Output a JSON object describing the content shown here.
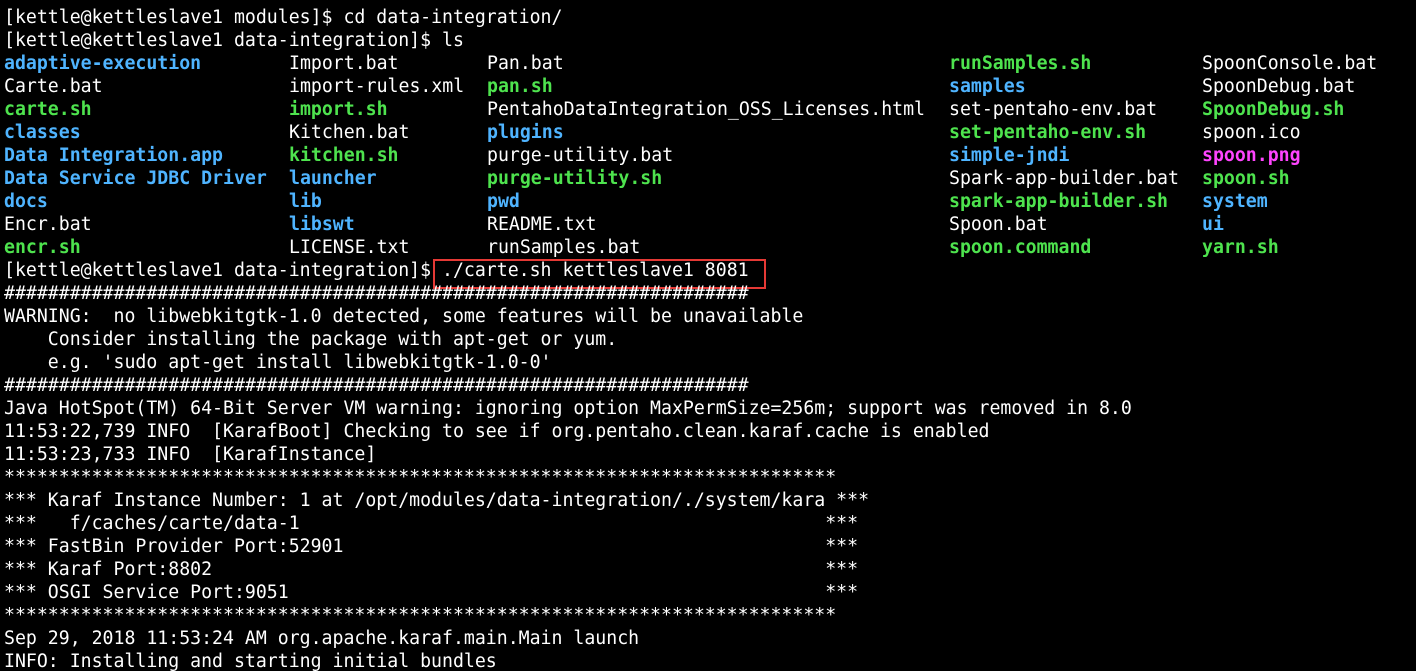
{
  "colors": {
    "background": "#000000",
    "plain": "#ffffff",
    "directory": "#4fb4ff",
    "executable": "#4ee34e",
    "image": "#ff44ff",
    "highlight": "#e53935"
  },
  "terminal": {
    "line1": "[kettle@kettleslave1 modules]$ cd data-integration/",
    "line2": "[kettle@kettleslave1 data-integration]$ ls",
    "listing": [
      [
        {
          "text": "adaptive-execution",
          "type": "dir"
        },
        {
          "text": "Import.bat",
          "type": "plain"
        },
        {
          "text": "Pan.bat",
          "type": "plain"
        },
        {
          "text": "runSamples.sh",
          "type": "exec"
        },
        {
          "text": "SpoonConsole.bat",
          "type": "plain"
        }
      ],
      [
        {
          "text": "Carte.bat",
          "type": "plain"
        },
        {
          "text": "import-rules.xml",
          "type": "plain"
        },
        {
          "text": "pan.sh",
          "type": "exec"
        },
        {
          "text": "samples",
          "type": "dir"
        },
        {
          "text": "SpoonDebug.bat",
          "type": "plain"
        }
      ],
      [
        {
          "text": "carte.sh",
          "type": "exec"
        },
        {
          "text": "import.sh",
          "type": "exec"
        },
        {
          "text": "PentahoDataIntegration_OSS_Licenses.html",
          "type": "plain"
        },
        {
          "text": "set-pentaho-env.bat",
          "type": "plain"
        },
        {
          "text": "SpoonDebug.sh",
          "type": "exec"
        }
      ],
      [
        {
          "text": "classes",
          "type": "dir"
        },
        {
          "text": "Kitchen.bat",
          "type": "plain"
        },
        {
          "text": "plugins",
          "type": "dir"
        },
        {
          "text": "set-pentaho-env.sh",
          "type": "exec"
        },
        {
          "text": "spoon.ico",
          "type": "plain"
        }
      ],
      [
        {
          "text": "Data Integration.app",
          "type": "dir"
        },
        {
          "text": "kitchen.sh",
          "type": "exec"
        },
        {
          "text": "purge-utility.bat",
          "type": "plain"
        },
        {
          "text": "simple-jndi",
          "type": "dir"
        },
        {
          "text": "spoon.png",
          "type": "image"
        }
      ],
      [
        {
          "text": "Data Service JDBC Driver",
          "type": "dir"
        },
        {
          "text": "launcher",
          "type": "dir"
        },
        {
          "text": "purge-utility.sh",
          "type": "exec"
        },
        {
          "text": "Spark-app-builder.bat",
          "type": "plain"
        },
        {
          "text": "spoon.sh",
          "type": "exec"
        }
      ],
      [
        {
          "text": "docs",
          "type": "dir"
        },
        {
          "text": "lib",
          "type": "dir"
        },
        {
          "text": "pwd",
          "type": "dir"
        },
        {
          "text": "spark-app-builder.sh",
          "type": "exec"
        },
        {
          "text": "system",
          "type": "dir"
        }
      ],
      [
        {
          "text": "Encr.bat",
          "type": "plain"
        },
        {
          "text": "libswt",
          "type": "dir"
        },
        {
          "text": "README.txt",
          "type": "plain"
        },
        {
          "text": "Spoon.bat",
          "type": "plain"
        },
        {
          "text": "ui",
          "type": "dir"
        }
      ],
      [
        {
          "text": "encr.sh",
          "type": "exec"
        },
        {
          "text": "LICENSE.txt",
          "type": "plain"
        },
        {
          "text": "runSamples.bat",
          "type": "plain"
        },
        {
          "text": "spoon.command",
          "type": "exec"
        },
        {
          "text": "yarn.sh",
          "type": "exec"
        }
      ]
    ],
    "prompt3": "[kettle@kettleslave1 data-integration]$ ",
    "command3": "./carte.sh kettleslave1 8081",
    "output": [
      "####################################################################",
      "WARNING:  no libwebkitgtk-1.0 detected, some features will be unavailable",
      "    Consider installing the package with apt-get or yum.",
      "    e.g. 'sudo apt-get install libwebkitgtk-1.0-0'",
      "####################################################################",
      "Java HotSpot(TM) 64-Bit Server VM warning: ignoring option MaxPermSize=256m; support was removed in 8.0",
      "11:53:22,739 INFO  [KarafBoot] Checking to see if org.pentaho.clean.karaf.cache is enabled",
      "11:53:23,733 INFO  [KarafInstance]",
      "****************************************************************************",
      "*** Karaf Instance Number: 1 at /opt/modules/data-integration/./system/kara ***",
      "***   f/caches/carte/data-1                                                ***",
      "*** FastBin Provider Port:52901                                            ***",
      "*** Karaf Port:8802                                                        ***",
      "*** OSGI Service Port:9051                                                 ***",
      "****************************************************************************",
      "Sep 29, 2018 11:53:24 AM org.apache.karaf.main.Main launch",
      "INFO: Installing and starting initial bundles"
    ]
  }
}
